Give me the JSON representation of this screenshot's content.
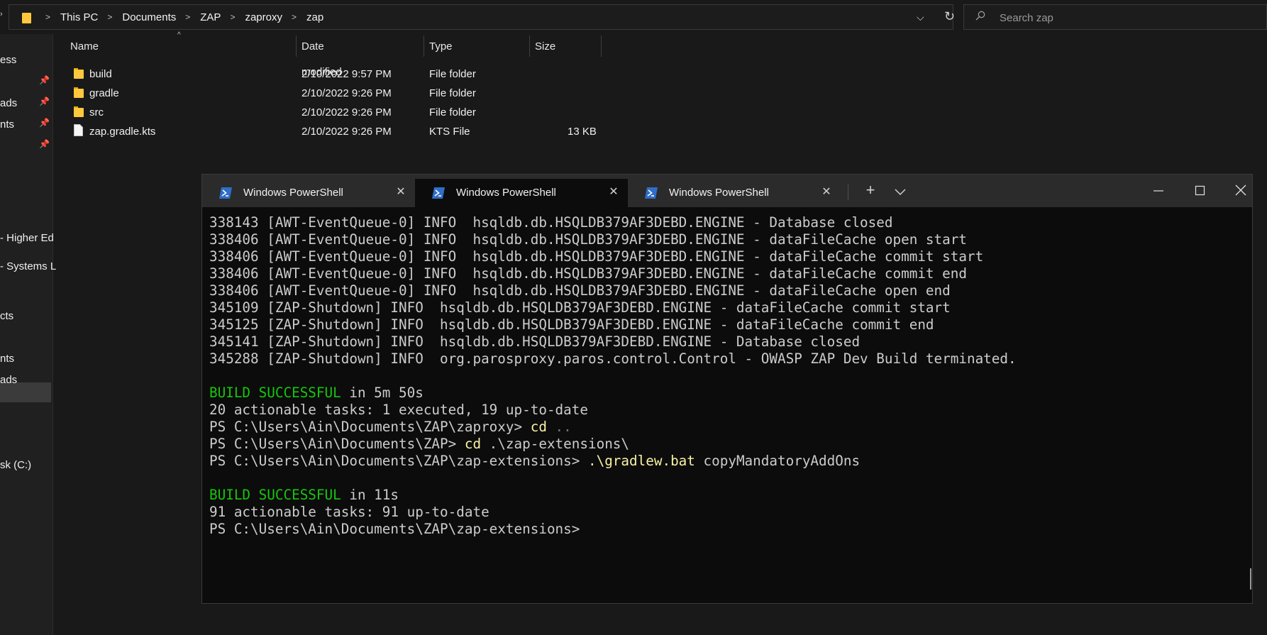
{
  "address_bar": {
    "breadcrumbs": [
      "This PC",
      "Documents",
      "ZAP",
      "zaproxy",
      "zap"
    ],
    "search_placeholder": "Search zap"
  },
  "sidebar": {
    "items": [
      {
        "label": "ess",
        "pinned": false
      },
      {
        "label": "",
        "pinned": true
      },
      {
        "label": "ads",
        "pinned": true
      },
      {
        "label": "nts",
        "pinned": true
      },
      {
        "label": "",
        "pinned": true
      },
      {
        "label": "- Higher Ed",
        "pinned": false
      },
      {
        "label": "- Systems L",
        "pinned": false
      },
      {
        "label": "cts",
        "pinned": false
      },
      {
        "label": "nts",
        "pinned": false,
        "selected": true
      },
      {
        "label": "ads",
        "pinned": false
      },
      {
        "label": "sk (C:)",
        "pinned": false
      }
    ]
  },
  "file_list": {
    "columns": [
      "Name",
      "Date modified",
      "Type",
      "Size"
    ],
    "rows": [
      {
        "name": "build",
        "date": "2/10/2022 9:57 PM",
        "type": "File folder",
        "size": "",
        "icon": "folder-icon"
      },
      {
        "name": "gradle",
        "date": "2/10/2022 9:26 PM",
        "type": "File folder",
        "size": "",
        "icon": "folder-icon"
      },
      {
        "name": "src",
        "date": "2/10/2022 9:26 PM",
        "type": "File folder",
        "size": "",
        "icon": "folder-icon"
      },
      {
        "name": "zap.gradle.kts",
        "date": "2/10/2022 9:26 PM",
        "type": "KTS File",
        "size": "13 KB",
        "icon": "file-icon"
      }
    ]
  },
  "terminal": {
    "tabs": [
      {
        "title": "Windows PowerShell",
        "active": false
      },
      {
        "title": "Windows PowerShell",
        "active": true
      },
      {
        "title": "Windows PowerShell",
        "active": false
      }
    ],
    "colors": {
      "green": "#16c60c",
      "yellow": "#f9f1a5",
      "gray": "#767676",
      "text": "#cccccc",
      "background": "#0c0c0c"
    },
    "lines": [
      [
        {
          "t": "338143 [AWT-EventQueue-0] INFO  hsqldb.db.HSQLDB379AF3DEBD.ENGINE - Database closed",
          "c": "default"
        }
      ],
      [
        {
          "t": "338406 [AWT-EventQueue-0] INFO  hsqldb.db.HSQLDB379AF3DEBD.ENGINE - dataFileCache open start",
          "c": "default"
        }
      ],
      [
        {
          "t": "338406 [AWT-EventQueue-0] INFO  hsqldb.db.HSQLDB379AF3DEBD.ENGINE - dataFileCache commit start",
          "c": "default"
        }
      ],
      [
        {
          "t": "338406 [AWT-EventQueue-0] INFO  hsqldb.db.HSQLDB379AF3DEBD.ENGINE - dataFileCache commit end",
          "c": "default"
        }
      ],
      [
        {
          "t": "338406 [AWT-EventQueue-0] INFO  hsqldb.db.HSQLDB379AF3DEBD.ENGINE - dataFileCache open end",
          "c": "default"
        }
      ],
      [
        {
          "t": "345109 [ZAP-Shutdown] INFO  hsqldb.db.HSQLDB379AF3DEBD.ENGINE - dataFileCache commit start",
          "c": "default"
        }
      ],
      [
        {
          "t": "345125 [ZAP-Shutdown] INFO  hsqldb.db.HSQLDB379AF3DEBD.ENGINE - dataFileCache commit end",
          "c": "default"
        }
      ],
      [
        {
          "t": "345141 [ZAP-Shutdown] INFO  hsqldb.db.HSQLDB379AF3DEBD.ENGINE - Database closed",
          "c": "default"
        }
      ],
      [
        {
          "t": "345288 [ZAP-Shutdown] INFO  org.parosproxy.paros.control.Control - OWASP ZAP Dev Build terminated.",
          "c": "default"
        }
      ],
      [],
      [
        {
          "t": "BUILD SUCCESSFUL",
          "c": "green"
        },
        {
          "t": " in 5m 50s",
          "c": "default"
        }
      ],
      [
        {
          "t": "20 actionable tasks: 1 executed, 19 up-to-date",
          "c": "default"
        }
      ],
      [
        {
          "t": "PS C:\\Users\\Ain\\Documents\\ZAP\\zaproxy> ",
          "c": "default"
        },
        {
          "t": "cd",
          "c": "yellow"
        },
        {
          "t": " ..",
          "c": "gray"
        }
      ],
      [
        {
          "t": "PS C:\\Users\\Ain\\Documents\\ZAP> ",
          "c": "default"
        },
        {
          "t": "cd",
          "c": "yellow"
        },
        {
          "t": " .\\zap-extensions\\",
          "c": "default"
        }
      ],
      [
        {
          "t": "PS C:\\Users\\Ain\\Documents\\ZAP\\zap-extensions> ",
          "c": "default"
        },
        {
          "t": ".\\gradlew.bat",
          "c": "yellow"
        },
        {
          "t": " copyMandatoryAddOns",
          "c": "default"
        }
      ],
      [],
      [
        {
          "t": "BUILD SUCCESSFUL",
          "c": "green"
        },
        {
          "t": " in 11s",
          "c": "default"
        }
      ],
      [
        {
          "t": "91 actionable tasks: 91 up-to-date",
          "c": "default"
        }
      ],
      [
        {
          "t": "PS C:\\Users\\Ain\\Documents\\ZAP\\zap-extensions>",
          "c": "default"
        }
      ]
    ]
  }
}
